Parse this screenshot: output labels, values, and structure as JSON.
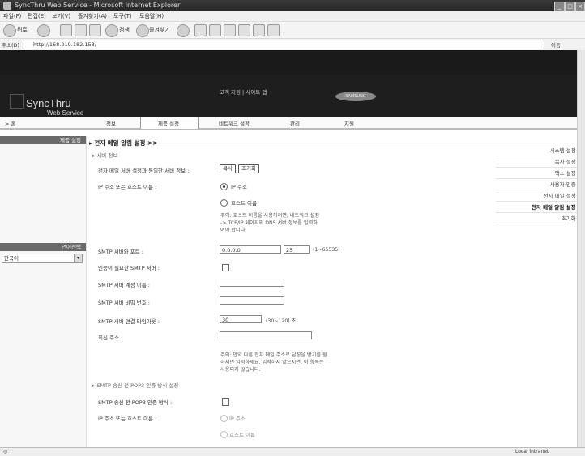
{
  "window": {
    "title": "SyncThru Web Service - Microsoft Internet Explorer"
  },
  "menu": [
    "파일(F)",
    "편집(E)",
    "보기(V)",
    "즐겨찾기(A)",
    "도구(T)",
    "도움말(H)"
  ],
  "toolbar": {
    "back_label": "뒤로",
    "search_label": "검색",
    "favorites_label": "즐겨찾기"
  },
  "address": {
    "label": "주소(D)",
    "url": "http://168.219.182.153/",
    "go_label": "이동"
  },
  "header": {
    "logo": "SyncThru",
    "logo_sub": "Web Service",
    "links": "고객 지원  |  사이트 맵",
    "brand": "SAMSUNG"
  },
  "nav": {
    "home": "> 홈",
    "tabs": [
      "정보",
      "제품 설정",
      "네트워크 설정",
      "관리",
      "지원"
    ]
  },
  "sidebar": {
    "heading": "제품 설정",
    "items": [
      "시스템 설정 ▸",
      "복사 설정 ▸",
      "팩스 설정 ▸",
      "사용자 인증 ▸",
      "전자 메일 설정 ▸",
      "전자 메일 알림 설정 ▸",
      "초기화 ▸"
    ],
    "language_heading": "언어선택",
    "language_value": "한국어"
  },
  "main": {
    "title": "▸ 전자 메일 알림 설정 >>",
    "section_server": "▸ 서버 정보",
    "same_as_label": "전자 메일 서버 설정과 동일한 서버 정보 :",
    "copy_button": "복사",
    "reset_button": "초기화",
    "ip_host_label": "IP 주소 또는 호스트 이름 :",
    "radio_ip": "IP 주소",
    "radio_host": "호스트 이름",
    "note1": "주의: 호스트 이름을 사용하려면, 네트워크 설정 -> TCP/IP 페이지의 DNS 서버 정보를 입력하여야 합니다.",
    "smtp_server_label": "SMTP 서버와 포트 :",
    "smtp_server_value": "0.0.0.0",
    "smtp_port_value": "25",
    "smtp_port_hint": "(1~65535)",
    "smtp_auth_label": "인증이 필요한 SMTP 서버 :",
    "smtp_account_label": "SMTP 서버 계정 이름 :",
    "smtp_password_label": "SMTP 서버 비밀 번호 :",
    "timeout_label": "SMTP 서버 연결 타임아웃 :",
    "timeout_value": "30",
    "timeout_hint": "(30~120) 초",
    "reply_label": "회신 주소 :",
    "note2": "주의: 만약 다른 전자 메일 주소로 답장을 받기를 원하시면 입력하세요. 입력하지 않으시면, 이 항목은 사용되지 않습니다.",
    "section_pop3": "▸ SMTP 송신 전 POP3 인증 방식 설정",
    "pop3_auth_label": "SMTP 송신 전 POP3 인증 방식 :",
    "pop3_ip_host_label": "IP 주소 또는 호스트 이름 :",
    "pop3_radio_ip": "IP 주소",
    "pop3_radio_host": "호스트 이름"
  },
  "status": {
    "zone": "Local intranet"
  }
}
